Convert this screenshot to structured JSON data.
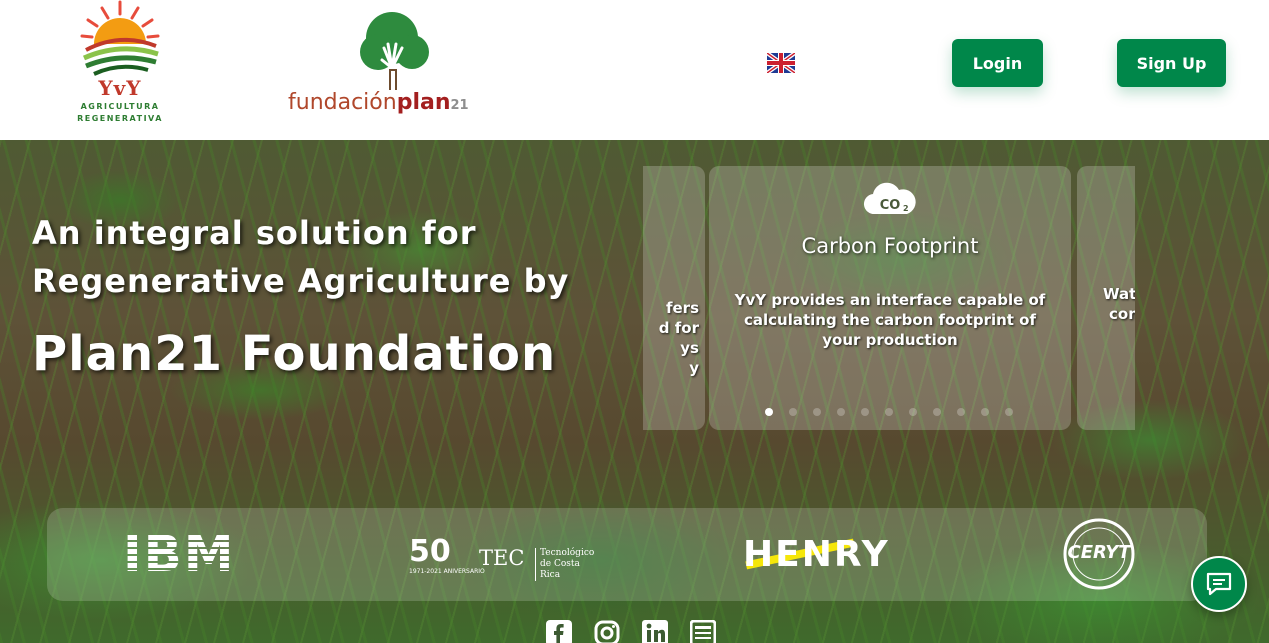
{
  "header": {
    "logo_yvy": {
      "name": "YvY",
      "line1": "AGRICULTURA",
      "line2": "REGENERATIVA"
    },
    "logo_plan21": {
      "part1": "fundación",
      "part2": "plan",
      "part3": "21"
    },
    "language_icon": "uk-flag-icon",
    "login_label": "Login",
    "signup_label": "Sign Up"
  },
  "hero": {
    "line1": "An integral solution for",
    "line2": "Regenerative Agriculture by",
    "line3": "Plan21 Foundation"
  },
  "carousel": {
    "left_card_fragment": [
      "fers",
      "d for",
      "ys",
      "y"
    ],
    "main_card": {
      "icon": "co2-cloud-icon",
      "title": "Carbon Footprint",
      "description": "YvY provides an interface capable of calculating the carbon footprint of your production"
    },
    "right_card_fragment": [
      "Wat",
      "",
      "con"
    ],
    "dot_count": 11,
    "active_dot": 0
  },
  "partners": {
    "ibm": "IBM",
    "tec_fifty": "50",
    "tec_anniv": "1971-2021 ANIVERSARIO",
    "tec_name": "TEC",
    "tec_sub1": "Tecnológico",
    "tec_sub2": "de Costa Rica",
    "henry": "HENRY",
    "cery": "CERYT"
  },
  "social": [
    "facebook-icon",
    "instagram-icon",
    "linkedin-icon",
    "document-icon"
  ],
  "chat_icon": "chat-icon",
  "colors": {
    "brand_green": "#00874a",
    "henry_yellow": "#f5e60a"
  }
}
